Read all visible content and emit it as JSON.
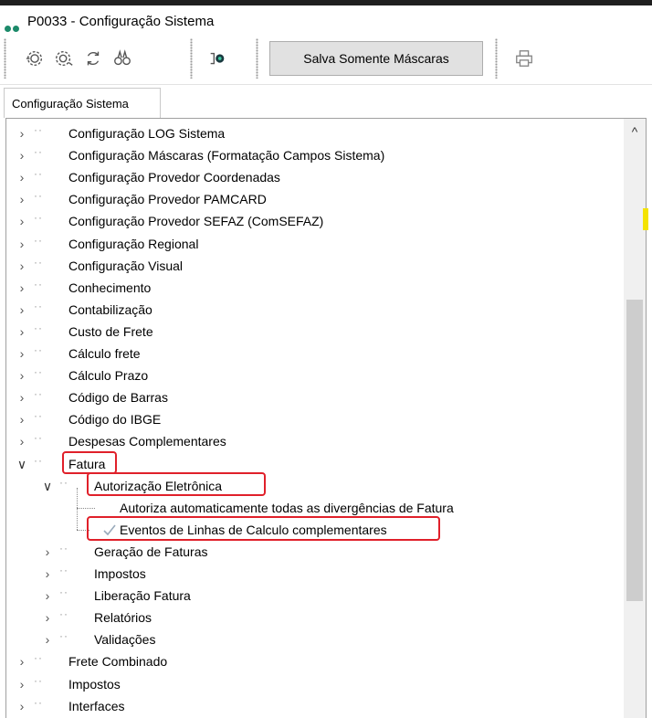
{
  "window": {
    "title": "P0033 - Configuração Sistema"
  },
  "toolbar": {
    "icons": [
      "gear-settings-icon",
      "gear-cog-icon",
      "refresh-icon",
      "binoculars-icon",
      "search-record-icon",
      "printer-icon"
    ],
    "save_masks_label": "Salva Somente Máscaras"
  },
  "tabs": [
    {
      "label": "Configuração Sistema",
      "active": true
    }
  ],
  "tree": {
    "items": [
      {
        "label": "Configuração LOG Sistema",
        "level": 0,
        "expanded": false
      },
      {
        "label": "Configuração Máscaras (Formatação Campos Sistema)",
        "level": 0,
        "expanded": false
      },
      {
        "label": "Configuração Provedor Coordenadas",
        "level": 0,
        "expanded": false
      },
      {
        "label": "Configuração Provedor PAMCARD",
        "level": 0,
        "expanded": false
      },
      {
        "label": "Configuração Provedor SEFAZ (ComSEFAZ)",
        "level": 0,
        "expanded": false
      },
      {
        "label": "Configuração Regional",
        "level": 0,
        "expanded": false
      },
      {
        "label": "Configuração Visual",
        "level": 0,
        "expanded": false
      },
      {
        "label": "Conhecimento",
        "level": 0,
        "expanded": false
      },
      {
        "label": "Contabilização",
        "level": 0,
        "expanded": false
      },
      {
        "label": "Custo de Frete",
        "level": 0,
        "expanded": false
      },
      {
        "label": "Cálculo frete",
        "level": 0,
        "expanded": false
      },
      {
        "label": "Cálculo Prazo",
        "level": 0,
        "expanded": false
      },
      {
        "label": "Código de Barras",
        "level": 0,
        "expanded": false
      },
      {
        "label": "Código do IBGE",
        "level": 0,
        "expanded": false
      },
      {
        "label": "Despesas Complementares",
        "level": 0,
        "expanded": false
      },
      {
        "label": "Fatura",
        "level": 0,
        "expanded": true,
        "highlighted": true
      },
      {
        "label": "Autorização Eletrônica",
        "level": 1,
        "expanded": true,
        "highlighted": true
      },
      {
        "label": "Autoriza automaticamente todas as divergências de Fatura",
        "level": 2,
        "leaf": true
      },
      {
        "label": "Eventos de Linhas de Calculo complementares",
        "level": 2,
        "leaf": true,
        "checked": true,
        "highlighted": true
      },
      {
        "label": "Geração de Faturas",
        "level": 1,
        "expanded": false
      },
      {
        "label": "Impostos",
        "level": 1,
        "expanded": false
      },
      {
        "label": "Liberação Fatura",
        "level": 1,
        "expanded": false
      },
      {
        "label": "Relatórios",
        "level": 1,
        "expanded": false
      },
      {
        "label": "Validações",
        "level": 1,
        "expanded": false
      },
      {
        "label": "Frete Combinado",
        "level": 0,
        "expanded": false
      },
      {
        "label": "Impostos",
        "level": 0,
        "expanded": false
      },
      {
        "label": "Interfaces",
        "level": 0,
        "expanded": false
      }
    ]
  },
  "colors": {
    "highlight": "#e0202a",
    "accent": "#1c8a6a"
  }
}
